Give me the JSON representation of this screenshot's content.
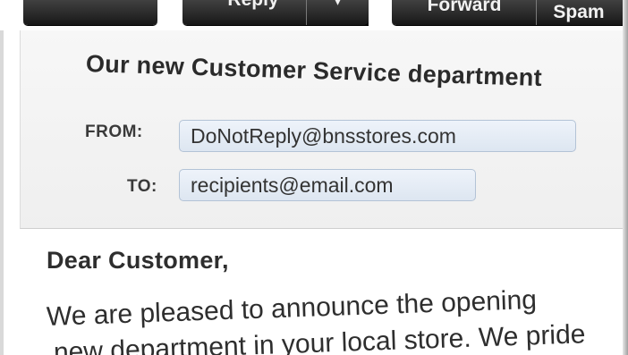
{
  "toolbar": {
    "buttons": [
      {
        "label": ""
      },
      {
        "label": "Reply"
      },
      {
        "label": "▾"
      },
      {
        "label": "Forward"
      },
      {
        "label": "Spam"
      }
    ]
  },
  "message": {
    "subject": "Our new Customer Service department",
    "from_label": "FROM:",
    "from_value": "DoNotReply@bnsstores.com",
    "to_label": "TO:",
    "to_value": "recipients@email.com"
  },
  "body": {
    "greeting": "Dear Customer,",
    "line1": "We are pleased to announce the opening",
    "line2": "new department in your local store. We pride"
  },
  "colors": {
    "toolbar_button": "#262626",
    "header_bg": "#f3f3f3",
    "address_pill_bg": "#e3ebf5",
    "address_pill_border": "#b3c3d6"
  }
}
